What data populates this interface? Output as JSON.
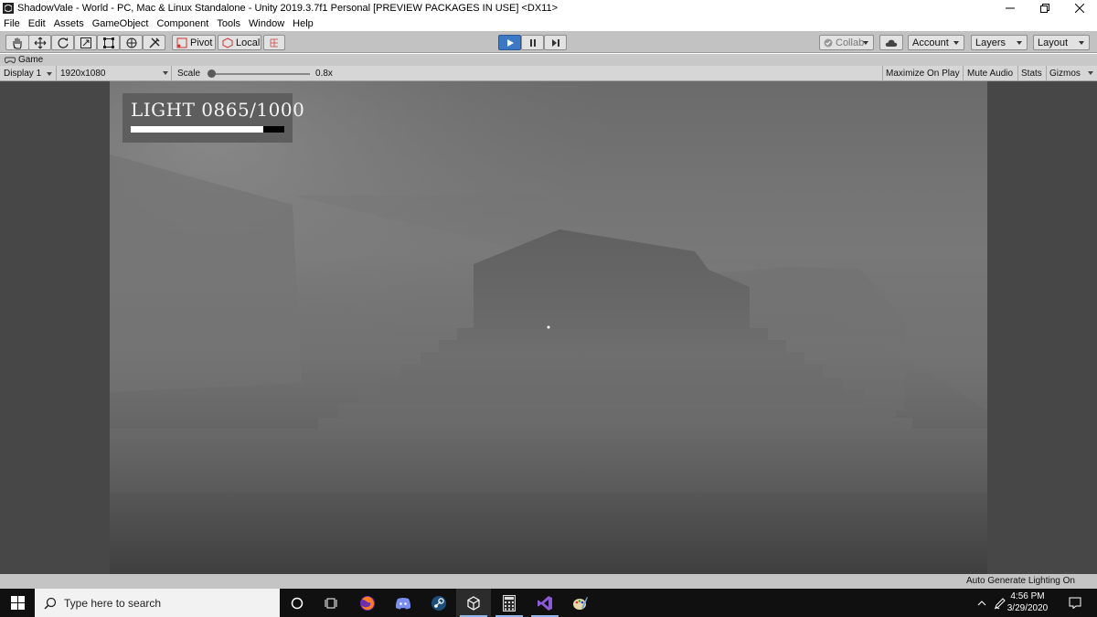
{
  "window": {
    "title": "ShadowVale - World - PC, Mac & Linux Standalone - Unity 2019.3.7f1 Personal [PREVIEW PACKAGES IN USE] <DX11>"
  },
  "menu": [
    "File",
    "Edit",
    "Assets",
    "GameObject",
    "Component",
    "Tools",
    "Window",
    "Help"
  ],
  "toolbar": {
    "pivot_label": "Pivot",
    "local_label": "Local",
    "collab_label": "Collab",
    "account_label": "Account",
    "layers_label": "Layers",
    "layout_label": "Layout"
  },
  "game_view": {
    "tab_label": "Game",
    "display": "Display 1",
    "resolution": "1920x1080",
    "scale_label": "Scale",
    "scale_value": "0.8x",
    "maximize_on_play": "Maximize On Play",
    "mute_audio": "Mute Audio",
    "stats": "Stats",
    "gizmos": "Gizmos"
  },
  "hud": {
    "light_text": "LIGHT 0865/1000",
    "light_fraction": 0.865
  },
  "status": {
    "text": "Auto Generate Lighting On"
  },
  "taskbar": {
    "search_placeholder": "Type here to search",
    "time": "4:56 PM",
    "date": "3/29/2020",
    "pinned": [
      "cortana-icon",
      "task-view-icon",
      "firefox-icon",
      "discord-icon",
      "steam-icon",
      "unity-icon",
      "calculator-icon",
      "visual-studio-icon",
      "paint-icon"
    ]
  }
}
